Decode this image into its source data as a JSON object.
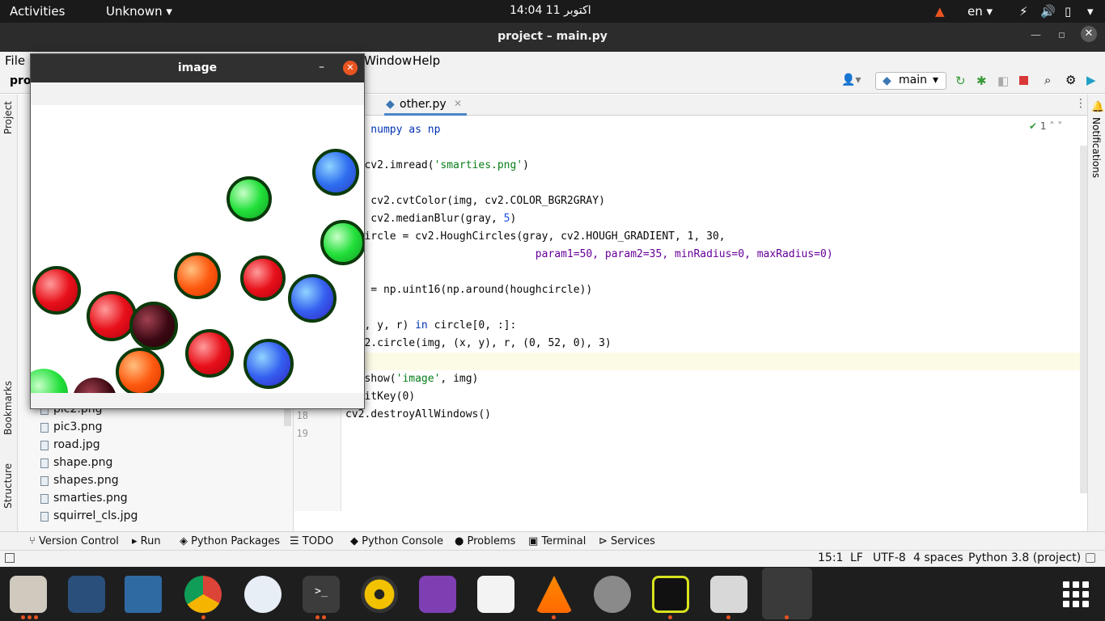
{
  "topbar": {
    "activities": "Activities",
    "app_menu": "Unknown",
    "clock": "14:04  11 اکتوبر",
    "lang": "en"
  },
  "window": {
    "title": "project – main.py"
  },
  "menu": {
    "file": "File",
    "proj_fragment": "proj",
    "window": "Window",
    "help": "Help"
  },
  "toolbar": {
    "run_config": "main"
  },
  "tabs": {
    "other": "other.py"
  },
  "inspections": {
    "count": "1"
  },
  "sidebar_left": {
    "project": "Project",
    "bookmarks": "Bookmarks",
    "structure": "Structure"
  },
  "sidebar_right": {
    "notifications": "Notifications"
  },
  "files": [
    "pic2.png",
    "pic3.png",
    "road.jpg",
    "shape.png",
    "shapes.png",
    "smarties.png",
    "squirrel_cls.jpg"
  ],
  "code": {
    "l2": "ort numpy as np",
    "l4a": " = cv2.imread(",
    "l4s": "'smarties.png'",
    "l4b": ")",
    "l6": "y = cv2.cvtColor(img, cv2.COLOR_BGR2GRAY)",
    "l7a": "y = cv2.medianBlur(gray, ",
    "l7n": "5",
    "l7b": ")",
    "l8": "ghcircle = cv2.HoughCircles(gray, cv2.HOUGH_GRADIENT, 1, 30,",
    "l9": "                              param1=50, param2=35, minRadius=0, maxRadius=0)",
    "l11": "cle = np.uint16(np.around(houghcircle))",
    "l13a": " (x, y, r) ",
    "l13k": "in",
    "l13b": " circle[0, :]:",
    "l14": " cv2.circle(img, (x, y), r, (0, 52, 0), 3)",
    "l16a": ".imshow(",
    "l16s": "'image'",
    "l16b": ", img)",
    "l17": ".waitKey(0)",
    "l18": "cv2.destroyAllWindows()"
  },
  "line_numbers": {
    "n18": "18",
    "n19": "19"
  },
  "bottom_tools": {
    "vcs": "Version Control",
    "run": "Run",
    "packages": "Python Packages",
    "todo": "TODO",
    "console": "Python Console",
    "problems": "Problems",
    "terminal": "Terminal",
    "services": "Services"
  },
  "status": {
    "pos": "15:1",
    "lf": "LF",
    "enc": "UTF-8",
    "indent": "4 spaces",
    "interp": "Python 3.8 (project)"
  },
  "image_window": {
    "title": "image"
  },
  "colors": {
    "accent_orange": "#e95420",
    "circle_outline": "#003400"
  }
}
